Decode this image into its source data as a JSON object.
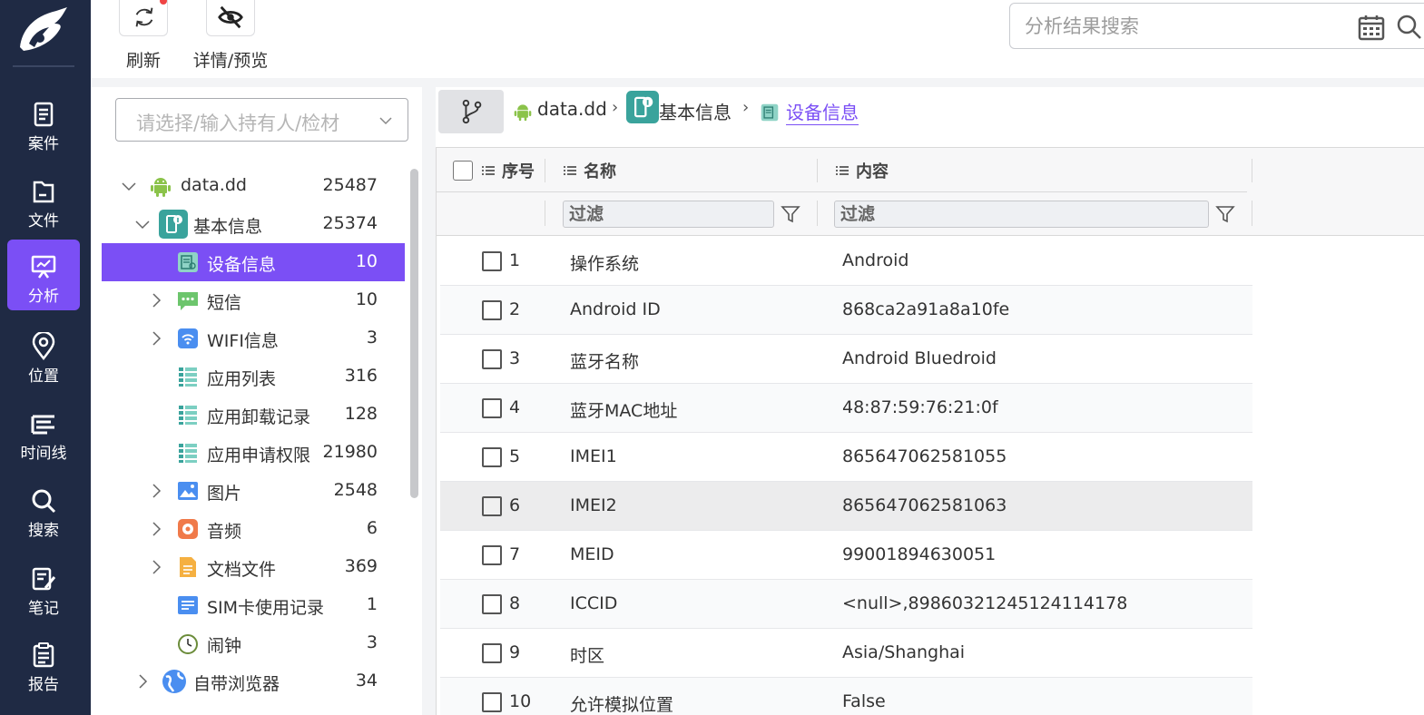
{
  "nav": {
    "items": [
      {
        "label": "案件",
        "icon": "case-icon"
      },
      {
        "label": "文件",
        "icon": "file-icon"
      },
      {
        "label": "分析",
        "icon": "analysis-icon",
        "active": true
      },
      {
        "label": "位置",
        "icon": "location-icon"
      },
      {
        "label": "时间线",
        "icon": "timeline-icon"
      },
      {
        "label": "搜索",
        "icon": "search-icon"
      },
      {
        "label": "笔记",
        "icon": "note-icon"
      },
      {
        "label": "报告",
        "icon": "report-icon"
      }
    ]
  },
  "toolbar": {
    "refresh_label": "刷新",
    "detail_label": "详情/预览",
    "search_placeholder": "分析结果搜索"
  },
  "tree": {
    "owner_placeholder": "请选择/输入持有人/检材",
    "items": [
      {
        "label": "data.dd",
        "count": "25487",
        "icon": "android-icon"
      },
      {
        "label": "基本信息",
        "count": "25374",
        "icon": "phone-info-icon"
      },
      {
        "label": "设备信息",
        "count": "10",
        "icon": "device-info-icon",
        "selected": true
      },
      {
        "label": "短信",
        "count": "10",
        "icon": "sms-icon"
      },
      {
        "label": "WIFI信息",
        "count": "3",
        "icon": "wifi-icon"
      },
      {
        "label": "应用列表",
        "count": "316",
        "icon": "list-icon"
      },
      {
        "label": "应用卸载记录",
        "count": "128",
        "icon": "list-icon"
      },
      {
        "label": "应用申请权限",
        "count": "21980",
        "icon": "list-icon"
      },
      {
        "label": "图片",
        "count": "2548",
        "icon": "image-icon"
      },
      {
        "label": "音频",
        "count": "6",
        "icon": "audio-icon"
      },
      {
        "label": "文档文件",
        "count": "369",
        "icon": "document-icon"
      },
      {
        "label": "SIM卡使用记录",
        "count": "1",
        "icon": "sim-icon"
      },
      {
        "label": "闹钟",
        "count": "3",
        "icon": "alarm-icon"
      },
      {
        "label": "自带浏览器",
        "count": "34",
        "icon": "browser-icon"
      }
    ]
  },
  "breadcrumb": {
    "root": "data.dd",
    "level1": "基本信息",
    "current": "设备信息"
  },
  "table": {
    "headers": {
      "index": "序号",
      "name": "名称",
      "content": "内容"
    },
    "filter_placeholder": "过滤",
    "rows": [
      {
        "index": "1",
        "name": "操作系统",
        "value": "Android"
      },
      {
        "index": "2",
        "name": "Android ID",
        "value": "868ca2a91a8a10fe"
      },
      {
        "index": "3",
        "name": "蓝牙名称",
        "value": "Android Bluedroid"
      },
      {
        "index": "4",
        "name": "蓝牙MAC地址",
        "value": "48:87:59:76:21:0f"
      },
      {
        "index": "5",
        "name": "IMEI1",
        "value": "865647062581055"
      },
      {
        "index": "6",
        "name": "IMEI2",
        "value": "865647062581063"
      },
      {
        "index": "7",
        "name": "MEID",
        "value": "99001894630051"
      },
      {
        "index": "8",
        "name": "ICCID",
        "value": "<null>,89860321245124114178"
      },
      {
        "index": "9",
        "name": "时区",
        "value": "Asia/Shanghai"
      },
      {
        "index": "10",
        "name": "允许模拟位置",
        "value": "False"
      }
    ]
  },
  "colors": {
    "nav_bg": "#1f2a44",
    "accent": "#7b4ff5",
    "android_green": "#8bc34a",
    "teal": "#3aa39c"
  }
}
